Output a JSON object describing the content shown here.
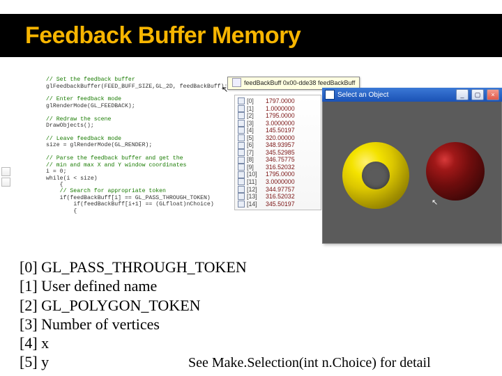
{
  "title": "Feedback Buffer Memory",
  "code": {
    "c1": "// Set the feedback buffer",
    "l1": "glFeedbackBuffer(FEED_BUFF_SIZE,GL_2D, feedBackBuff);",
    "c2": "// Enter feedback mode",
    "l2": "glRenderMode(GL_FEEDBACK);",
    "c3": "// Redraw the scene",
    "l3": "DrawObjects();",
    "c4": "// Leave feedback mode",
    "l4": "size = glRenderMode(GL_RENDER);",
    "c5": "// Parse the feedback buffer and get the",
    "c6": "// min and max X and Y window coordinates",
    "l5": "i = 0;",
    "l6": "while(i < size)",
    "l7": "{",
    "c7": "// Search for appropriate token",
    "l8": "if(feedBackBuff[i] == GL_PASS_THROUGH_TOKEN)",
    "l9": "if(feedBackBuff[i+1] == (GLfloat)nChoice)",
    "l10": "{"
  },
  "tooltip": {
    "label": "feedBackBuff",
    "addr": "0x00-dde38",
    "var": "feedBackBuff"
  },
  "watch": [
    {
      "k": "[0]",
      "v": "1797.0000"
    },
    {
      "k": "[1]",
      "v": "1.0000000"
    },
    {
      "k": "[2]",
      "v": "1795.0000"
    },
    {
      "k": "[3]",
      "v": "3.0000000"
    },
    {
      "k": "[4]",
      "v": "145.50197"
    },
    {
      "k": "[5]",
      "v": "320.00000"
    },
    {
      "k": "[6]",
      "v": "348.93957"
    },
    {
      "k": "[7]",
      "v": "345.52985"
    },
    {
      "k": "[8]",
      "v": "346.75775"
    },
    {
      "k": "[9]",
      "v": "316.52032"
    },
    {
      "k": "[10]",
      "v": "1795.0000"
    },
    {
      "k": "[11]",
      "v": "3.0000000"
    },
    {
      "k": "[12]",
      "v": "344.97757"
    },
    {
      "k": "[13]",
      "v": "316.52032"
    },
    {
      "k": "[14]",
      "v": "345.50197"
    }
  ],
  "glwin": {
    "title": "Select an Object"
  },
  "legend": [
    "[0] GL_PASS_THROUGH_TOKEN",
    "[1] User defined name",
    "[2] GL_POLYGON_TOKEN",
    "[3] Number of vertices",
    "[4] x",
    "[5] y"
  ],
  "footnote": "See Make.Selection(int n.Choice) for detail"
}
